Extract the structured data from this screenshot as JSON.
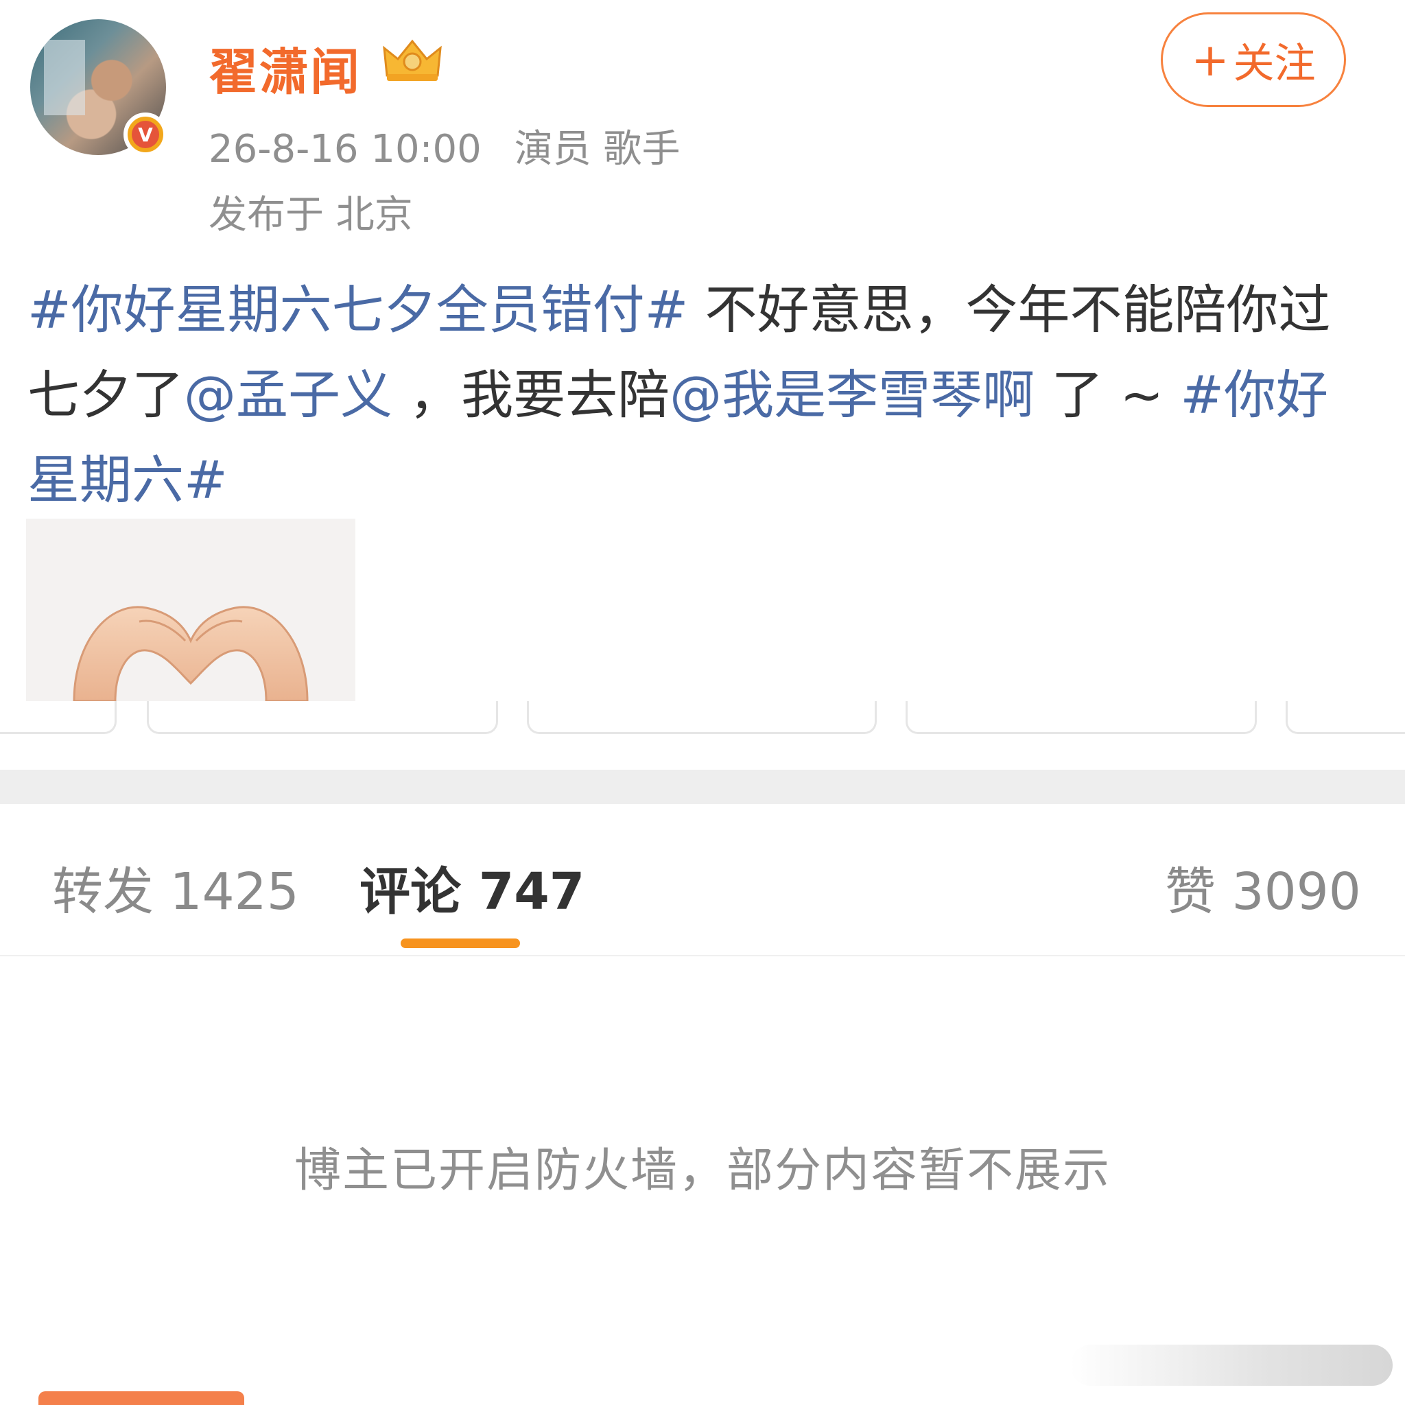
{
  "post": {
    "username": "翟潇闻",
    "follow_label": "关注",
    "follow_plus": "+",
    "time": "26-8-16 10:00",
    "tags_meta": "演员 歌手",
    "location": "发布于 北京",
    "verified_badge": "V",
    "content": {
      "tag1": "#你好星期六七夕全员错付#",
      "text1": " 不好意思，今年不能陪你过七夕了",
      "mention1": "@孟子义",
      "text2": " ，我要去陪",
      "mention2": "@我是李雪琴啊",
      "text3": " 了 ~ ",
      "tag2": "#你好星期六#"
    },
    "image_icon": "heart-hands-icon"
  },
  "tabs": {
    "repost": "转发 1425",
    "comment": "评论 747",
    "like": "赞 3090"
  },
  "comments": {
    "firewall_message": "博主已开启防火墙，部分内容暂不展示"
  },
  "colors": {
    "accent": "#f26a2c",
    "link": "#4a6aa5",
    "tab_indicator": "#f7931e"
  }
}
